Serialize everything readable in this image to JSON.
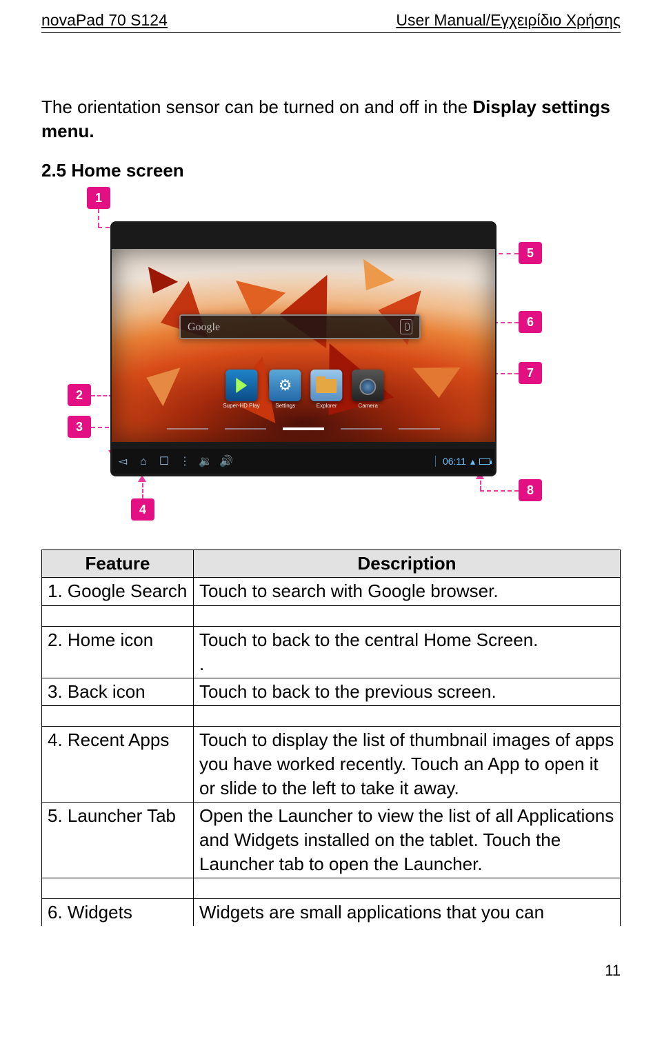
{
  "header": {
    "left": "novaPad 70 S124",
    "right": "User Manual/Εγχειρίδιο Χρήσης"
  },
  "intro": {
    "line1a": "The orientation sensor can be turned on and off in the ",
    "line1b": "Display settings menu.",
    "section": "2.5 Home screen"
  },
  "screenshot": {
    "search_g": "g",
    "widget_label": "Google",
    "apps": [
      {
        "cap": "Super-HD Play"
      },
      {
        "cap": "Settings"
      },
      {
        "cap": "Explorer"
      },
      {
        "cap": "Camera"
      }
    ],
    "time": "06:11",
    "callouts": {
      "c1": "1",
      "c2": "2",
      "c3": "3",
      "c4": "4",
      "c5": "5",
      "c6": "6",
      "c7": "7",
      "c8": "8"
    }
  },
  "table": {
    "h1": "Feature",
    "h2": "Description",
    "rows": [
      {
        "f": "1. Google Search",
        "d": "Touch to search with Google browser."
      },
      {
        "f": "2. Home icon",
        "d": "Touch to back to the central Home Screen.\n."
      },
      {
        "f": "3. Back icon",
        "d": "Touch to back to the previous screen."
      },
      {
        "f": "4. Recent Apps",
        "d": "Touch to display the list of thumbnail images of apps you have worked recently. Touch an App to open it or slide to the left to take it away."
      },
      {
        "f": "5. Launcher Tab",
        "d": "Open the Launcher to view the list of all Applications and Widgets installed on the tablet. Touch the Launcher tab to open the Launcher."
      },
      {
        "f": "6. Widgets",
        "d": "Widgets are small applications that you can"
      }
    ]
  },
  "page_number": "11"
}
